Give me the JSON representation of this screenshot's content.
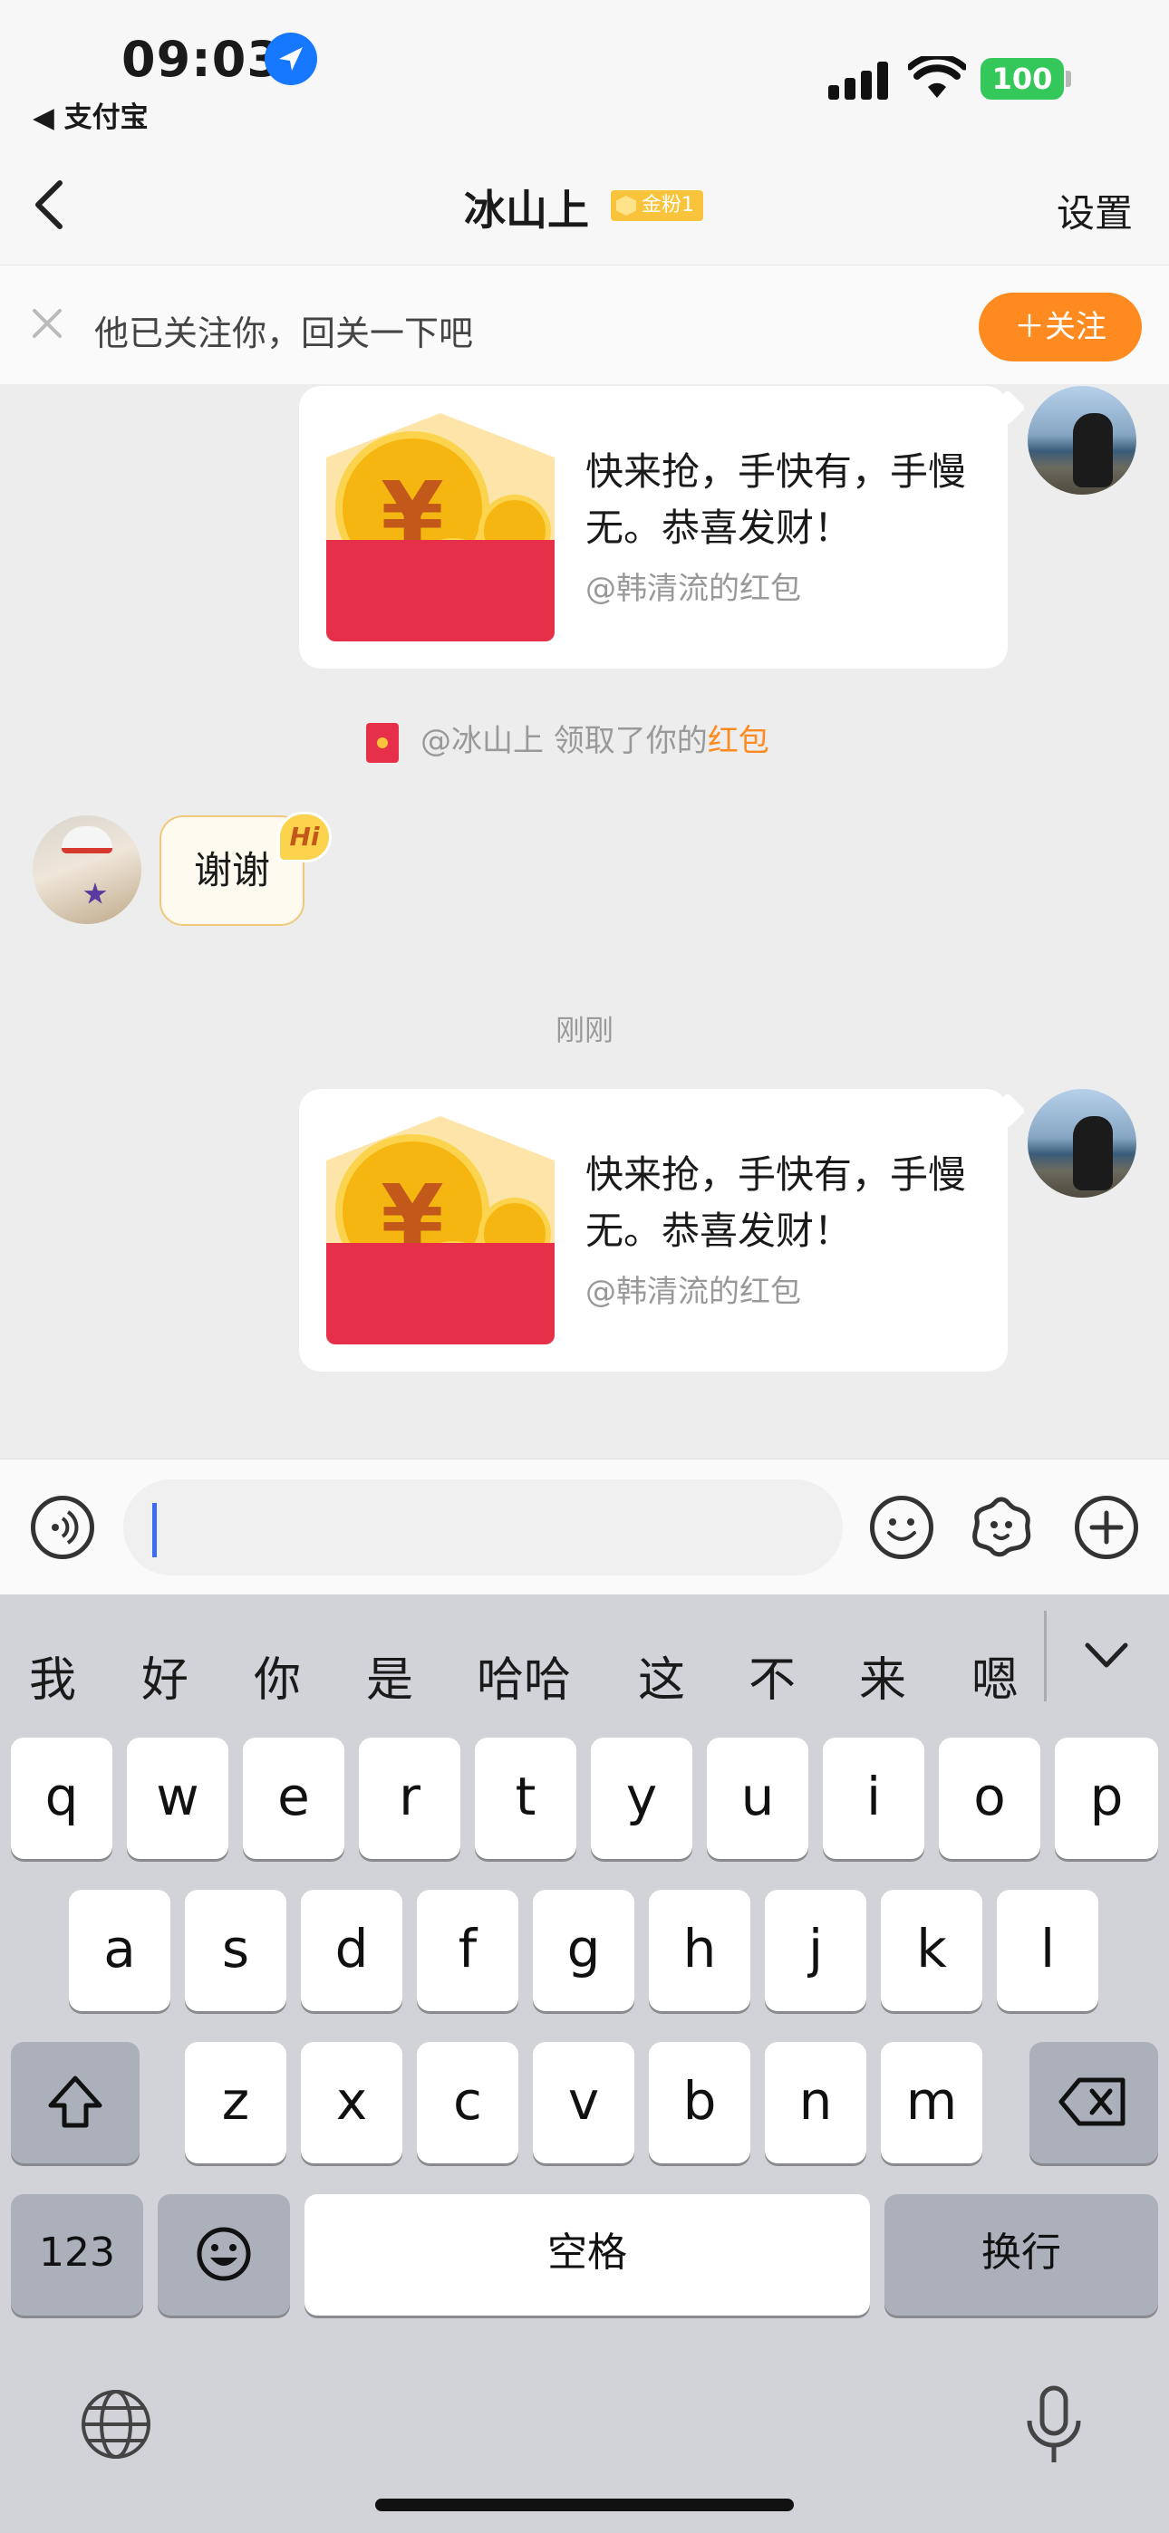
{
  "status_bar": {
    "time": "09:03",
    "back_app": "◀ 支付宝",
    "battery": "100"
  },
  "nav": {
    "title": "冰山上",
    "badge": "金粉1",
    "settings": "设置"
  },
  "follow_bar": {
    "text": "他已关注你，回关一下吧",
    "button": "＋关注"
  },
  "messages": {
    "red_packet_1": {
      "text": "快来抢，手快有，手慢无。恭喜发财！",
      "from": "@韩清流的红包"
    },
    "notice": {
      "prefix": "@冰山上 领取了你的",
      "highlight": "红包"
    },
    "reply": {
      "text": "谢谢",
      "badge": "Hi"
    },
    "time_divider": "刚刚",
    "red_packet_2": {
      "text": "快来抢，手快有，手慢无。恭喜发财！",
      "from": "@韩清流的红包"
    }
  },
  "input": {
    "value": ""
  },
  "keyboard": {
    "candidates": [
      "我",
      "好",
      "你",
      "是",
      "哈哈",
      "这",
      "不",
      "来",
      "嗯"
    ],
    "row1": [
      "q",
      "w",
      "e",
      "r",
      "t",
      "y",
      "u",
      "i",
      "o",
      "p"
    ],
    "row2": [
      "a",
      "s",
      "d",
      "f",
      "g",
      "h",
      "j",
      "k",
      "l"
    ],
    "row3": [
      "z",
      "x",
      "c",
      "v",
      "b",
      "n",
      "m"
    ],
    "numbers": "123",
    "space": "空格",
    "return": "换行"
  },
  "colors": {
    "accent": "#ff8a1f",
    "red_packet": "#e63049",
    "link_blue": "#1677ff",
    "battery": "#34c759"
  },
  "icons": [
    "location-arrow-icon",
    "signal-icon",
    "wifi-icon",
    "back-chevron-icon",
    "close-icon",
    "voice-icon",
    "emoji-icon",
    "sticker-icon",
    "plus-icon",
    "shift-icon",
    "delete-icon",
    "globe-icon",
    "mic-icon",
    "chevron-down-icon"
  ]
}
